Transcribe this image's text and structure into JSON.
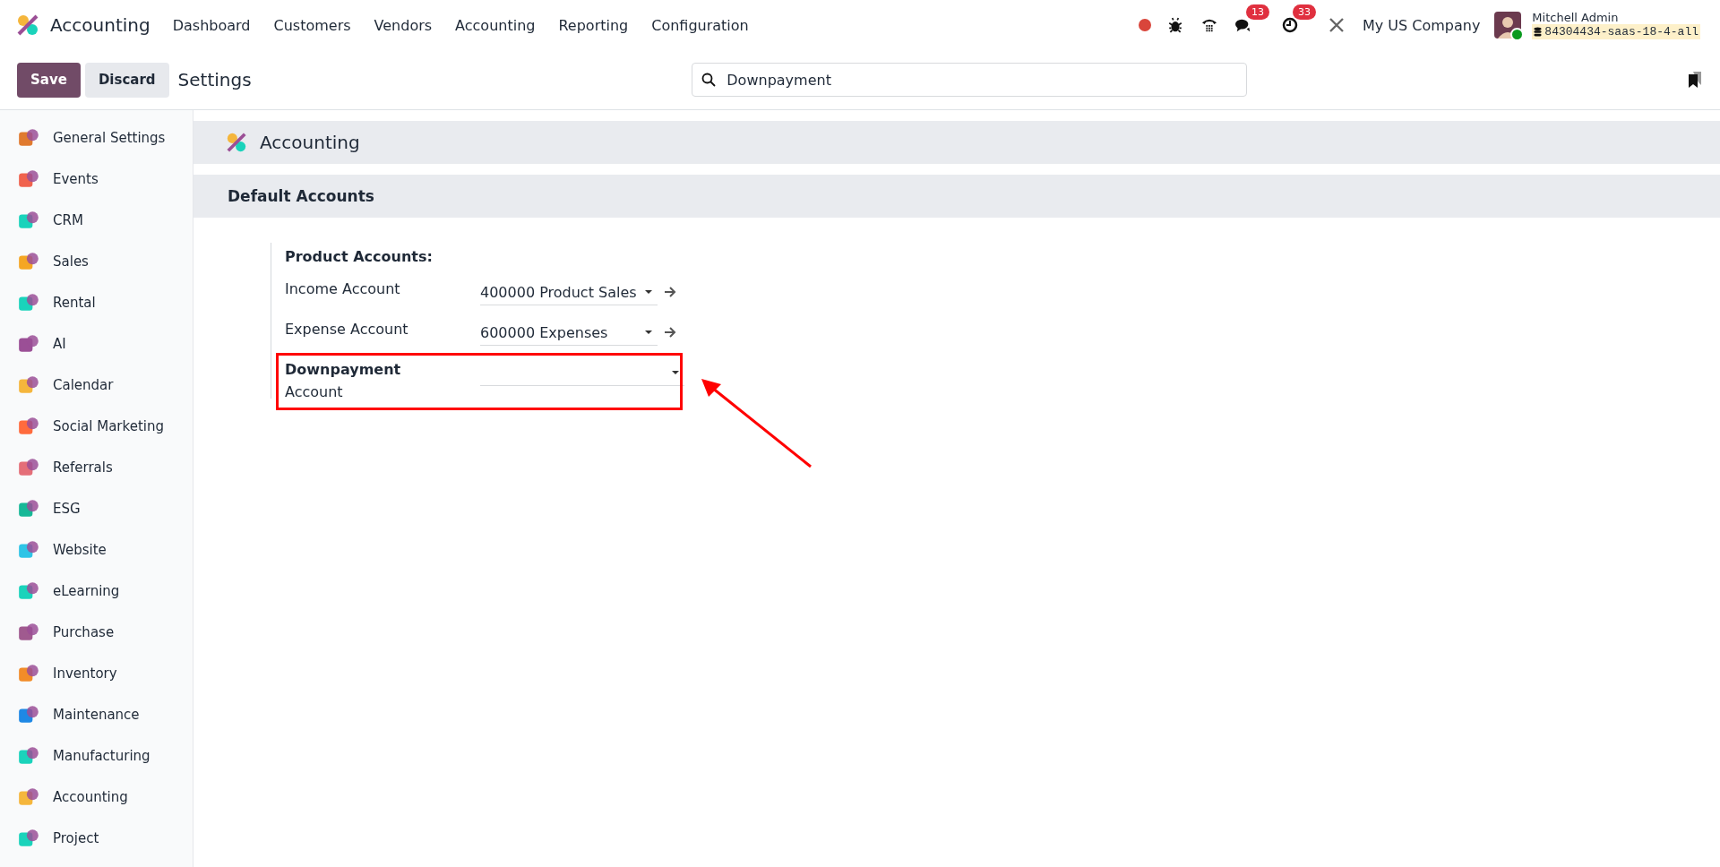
{
  "navbar": {
    "app_name": "Accounting",
    "menu": [
      "Dashboard",
      "Customers",
      "Vendors",
      "Accounting",
      "Reporting",
      "Configuration"
    ],
    "badges": [
      {
        "kind": "chat",
        "count": "13"
      },
      {
        "kind": "activity",
        "count": "33"
      }
    ],
    "company": "My US Company",
    "user": {
      "name": "Mitchell Admin",
      "database": "84304434-saas-18-4-all",
      "online": true
    }
  },
  "control_panel": {
    "buttons": [
      "Save",
      "Discard"
    ],
    "title": "Settings",
    "search": {
      "value": "Downpayment"
    }
  },
  "sidebar": {
    "items": [
      {
        "label": "General Settings",
        "color": "#e07a2f"
      },
      {
        "label": "Events",
        "color": "#f0624d"
      },
      {
        "label": "CRM",
        "color": "#1ad3bb"
      },
      {
        "label": "Sales",
        "color": "#f5a623"
      },
      {
        "label": "Rental",
        "color": "#1ad3bb"
      },
      {
        "label": "AI",
        "color": "#9b4f96"
      },
      {
        "label": "Calendar",
        "color": "#f5b63c"
      },
      {
        "label": "Social Marketing",
        "color": "#ff6b3d"
      },
      {
        "label": "Referrals",
        "color": "#e46e78"
      },
      {
        "label": "ESG",
        "color": "#17b897"
      },
      {
        "label": "Website",
        "color": "#2ec4e6"
      },
      {
        "label": "eLearning",
        "color": "#1ad3bb"
      },
      {
        "label": "Purchase",
        "color": "#a05a8f"
      },
      {
        "label": "Inventory",
        "color": "#f28c28"
      },
      {
        "label": "Maintenance",
        "color": "#1e88e5"
      },
      {
        "label": "Manufacturing",
        "color": "#1ad3bb"
      },
      {
        "label": "Accounting",
        "color": "#f5b63c"
      },
      {
        "label": "Project",
        "color": "#1ad3bb"
      }
    ]
  },
  "app_header": "Accounting",
  "section": {
    "title": "Default Accounts",
    "group": "Product Accounts:",
    "rows": [
      {
        "label": "Income Account",
        "value": "400000 Product Sales",
        "has_link": true
      },
      {
        "label": "Expense Account",
        "value": "600000 Expenses",
        "has_link": true
      },
      {
        "label": "**Downpayment** Account",
        "value": "",
        "has_link": false
      }
    ]
  }
}
